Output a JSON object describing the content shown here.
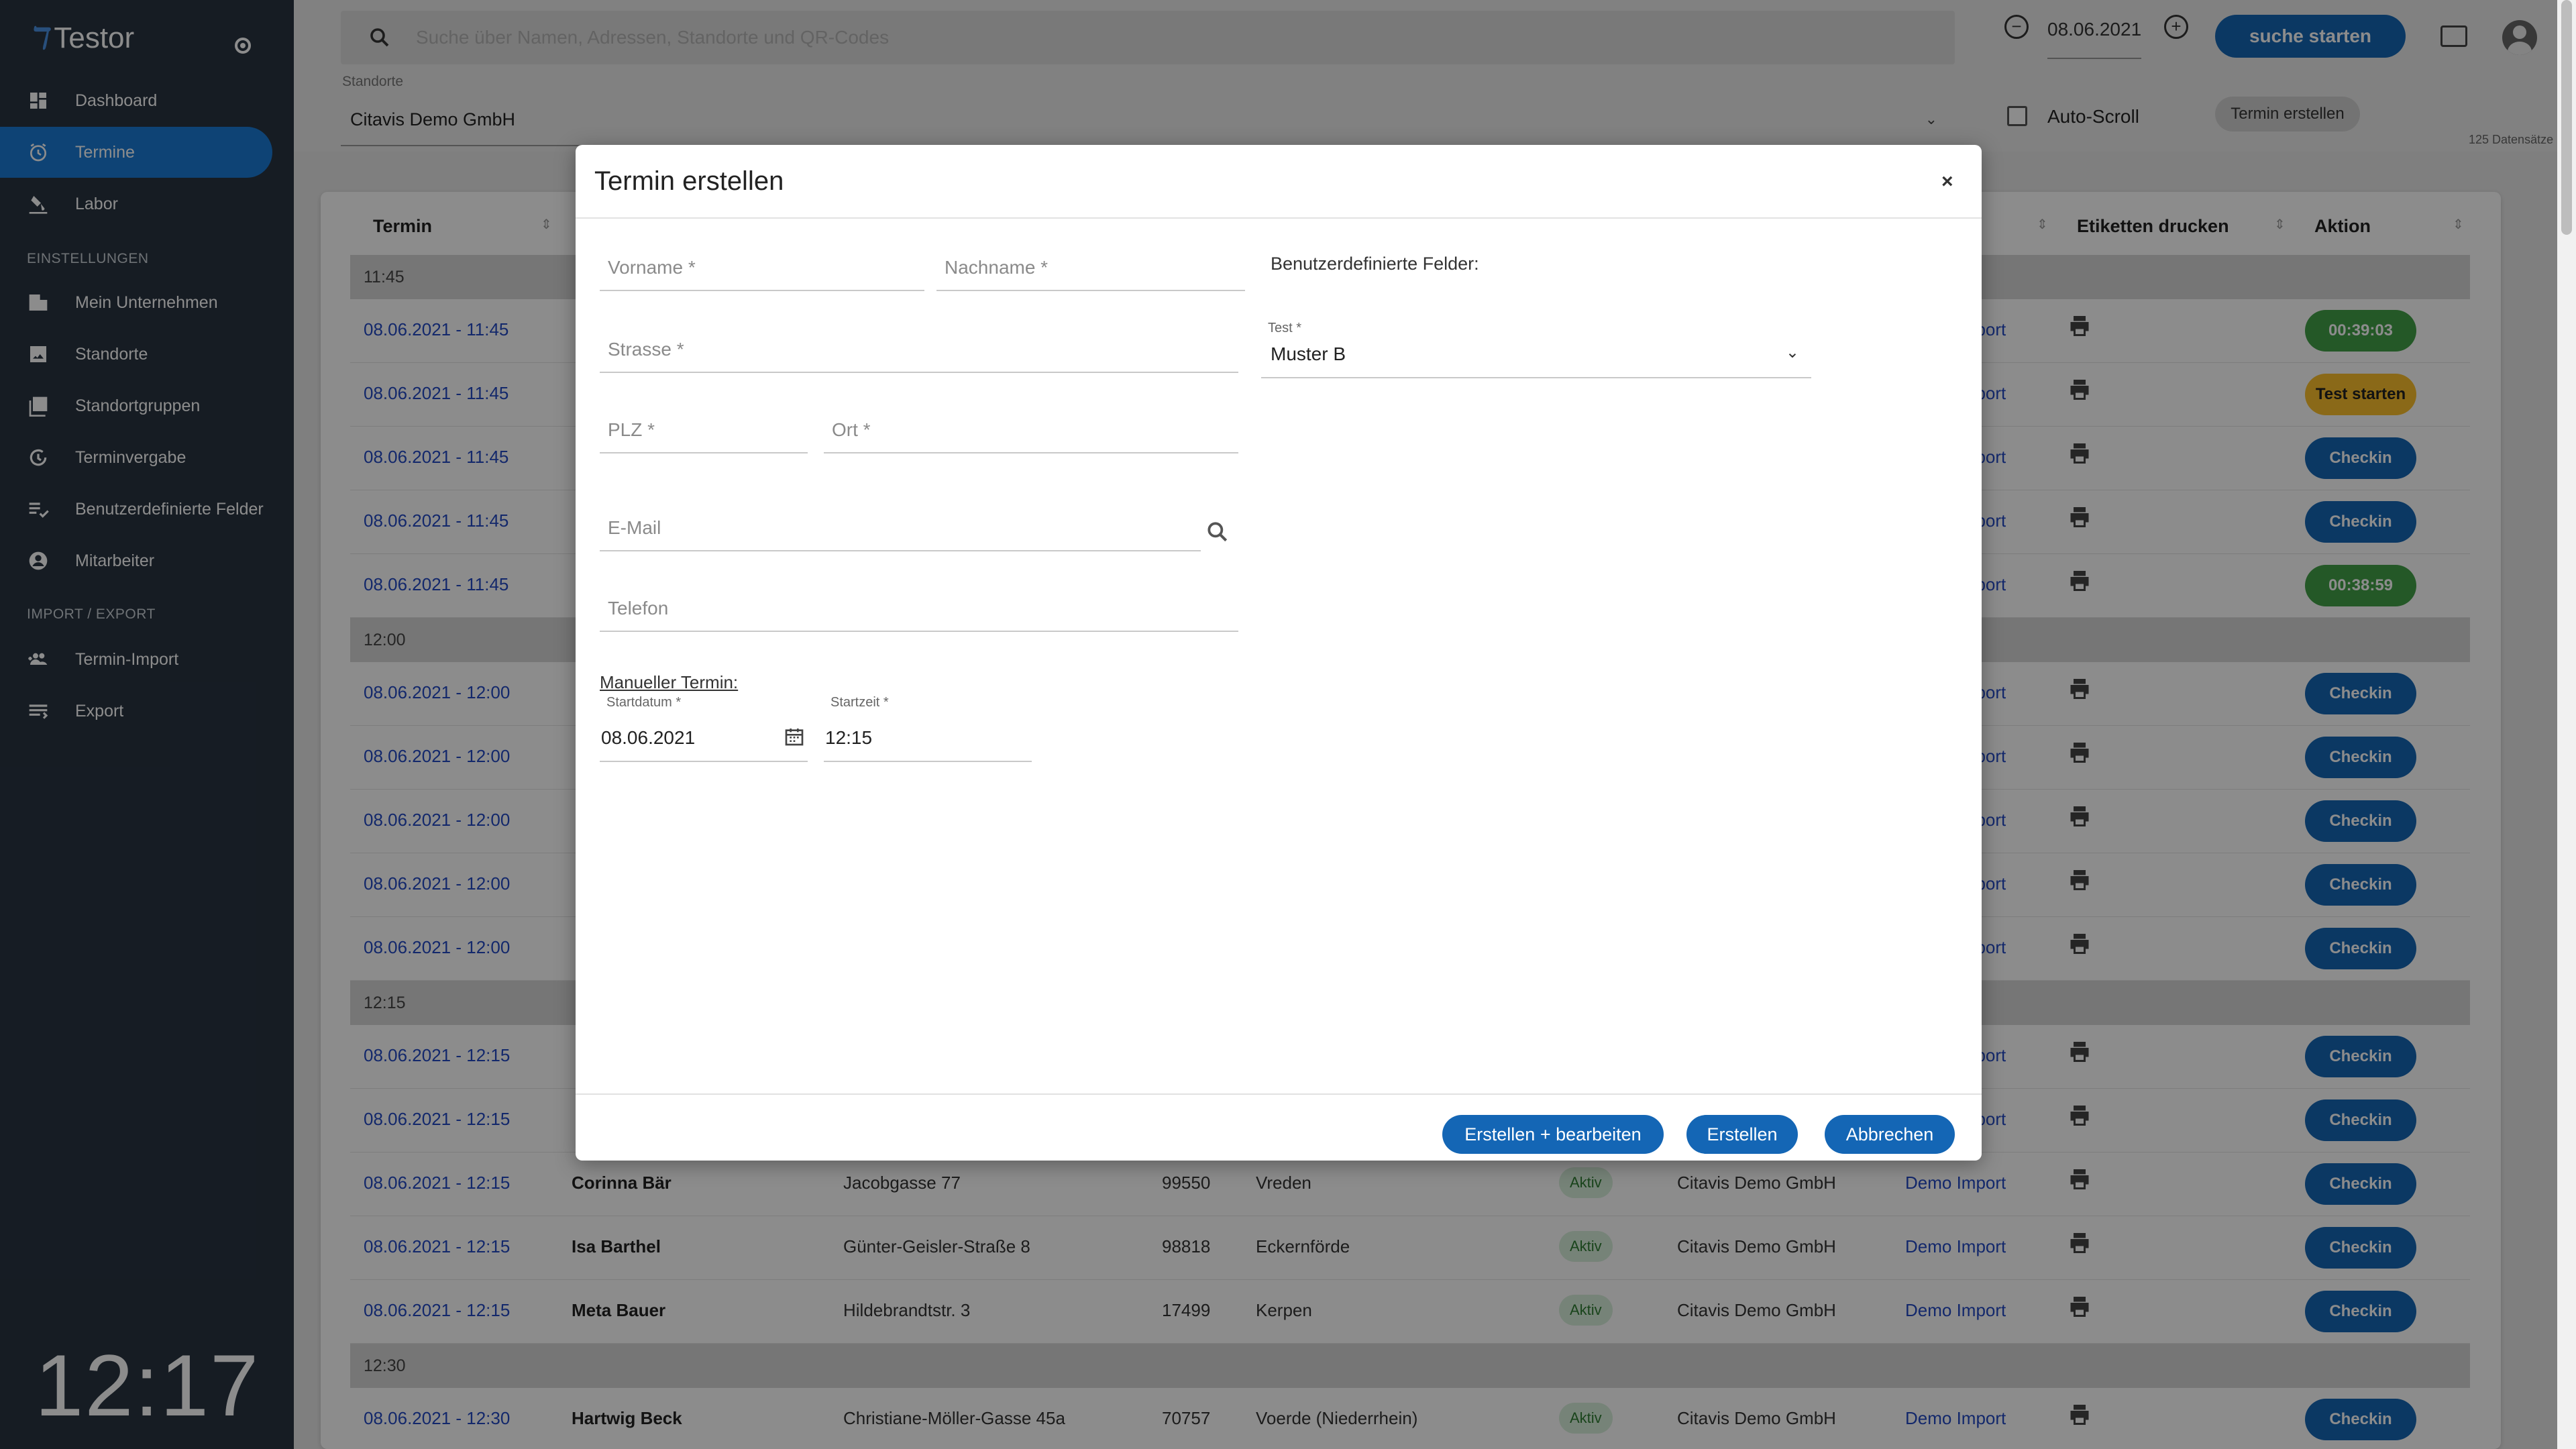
{
  "app": {
    "name": "Testor"
  },
  "sidebar": {
    "items": [
      {
        "label": "Dashboard",
        "icon": "dashboard-icon"
      },
      {
        "label": "Termine",
        "icon": "alarm-icon",
        "active": true
      },
      {
        "label": "Labor",
        "icon": "lab-icon"
      }
    ],
    "section_settings": "EINSTELLUNGEN",
    "settings_items": [
      {
        "label": "Mein Unternehmen",
        "icon": "building-icon"
      },
      {
        "label": "Standorte",
        "icon": "image-icon"
      },
      {
        "label": "Standortgruppen",
        "icon": "collection-icon"
      },
      {
        "label": "Terminvergabe",
        "icon": "refresh-clock-icon"
      },
      {
        "label": "Benutzerdefinierte Felder",
        "icon": "checklist-icon"
      },
      {
        "label": "Mitarbeiter",
        "icon": "person-icon"
      }
    ],
    "section_import": "IMPORT / EXPORT",
    "import_items": [
      {
        "label": "Termin-Import",
        "icon": "people-add-icon"
      },
      {
        "label": "Export",
        "icon": "export-lines-icon"
      }
    ],
    "clock": "12:17"
  },
  "topbar": {
    "search_placeholder": "Suche über Namen, Adressen, Standorte und QR-Codes",
    "date": "08.06.2021",
    "search_button": "suche starten",
    "location_label": "Standorte",
    "location_value": "Citavis Demo GmbH",
    "autoscroll_label": "Auto-Scroll",
    "create_button": "Termin erstellen",
    "records": "125 Datensätze"
  },
  "table": {
    "headers": {
      "termin": "Termin",
      "etiketten": "Etiketten drucken",
      "aktion": "Aktion"
    },
    "groups": [
      {
        "label": "11:45",
        "rows": [
          {
            "date": "08.06.2021 - 11:45",
            "action": "00:39:03",
            "kind": "timer"
          },
          {
            "date": "08.06.2021 - 11:45",
            "action": "Test starten",
            "kind": "test"
          },
          {
            "date": "08.06.2021 - 11:45",
            "action": "Checkin",
            "kind": "checkin"
          },
          {
            "date": "08.06.2021 - 11:45",
            "action": "Checkin",
            "kind": "checkin"
          },
          {
            "date": "08.06.2021 - 11:45",
            "action": "00:38:59",
            "kind": "timer"
          }
        ]
      },
      {
        "label": "12:00",
        "rows": [
          {
            "date": "08.06.2021 - 12:00",
            "action": "Checkin",
            "kind": "checkin"
          },
          {
            "date": "08.06.2021 - 12:00",
            "action": "Checkin",
            "kind": "checkin"
          },
          {
            "date": "08.06.2021 - 12:00",
            "action": "Checkin",
            "kind": "checkin"
          },
          {
            "date": "08.06.2021 - 12:00",
            "action": "Checkin",
            "kind": "checkin"
          },
          {
            "date": "08.06.2021 - 12:00",
            "action": "Checkin",
            "kind": "checkin"
          }
        ]
      },
      {
        "label": "12:15",
        "rows": [
          {
            "date": "08.06.2021 - 12:15",
            "action": "Checkin",
            "kind": "checkin"
          },
          {
            "date": "08.06.2021 - 12:15",
            "action": "Checkin",
            "kind": "checkin"
          },
          {
            "date": "08.06.2021 - 12:15",
            "name": "Corinna Bär",
            "street": "Jacobgasse 77",
            "plz": "99550",
            "city": "Vreden",
            "status": "Aktiv",
            "location": "Citavis Demo GmbH",
            "import": "Demo Import",
            "action": "Checkin",
            "kind": "checkin"
          },
          {
            "date": "08.06.2021 - 12:15",
            "name": "Isa Barthel",
            "street": "Günter-Geisler-Straße 8",
            "plz": "98818",
            "city": "Eckernförde",
            "status": "Aktiv",
            "location": "Citavis Demo GmbH",
            "import": "Demo Import",
            "action": "Checkin",
            "kind": "checkin"
          },
          {
            "date": "08.06.2021 - 12:15",
            "name": "Meta Bauer",
            "street": "Hildebrandtstr. 3",
            "plz": "17499",
            "city": "Kerpen",
            "status": "Aktiv",
            "location": "Citavis Demo GmbH",
            "import": "Demo Import",
            "action": "Checkin",
            "kind": "checkin"
          }
        ]
      },
      {
        "label": "12:30",
        "rows": [
          {
            "date": "08.06.2021 - 12:30",
            "name": "Hartwig Beck",
            "street": "Christiane-Möller-Gasse 45a",
            "plz": "70757",
            "city": "Voerde (Niederrhein)",
            "status": "Aktiv",
            "location": "Citavis Demo GmbH",
            "import": "Demo Import",
            "action": "Checkin",
            "kind": "checkin"
          }
        ]
      }
    ],
    "hidden_import": "Demo Import"
  },
  "modal": {
    "title": "Termin erstellen",
    "close": "×",
    "vorname_placeholder": "Vorname *",
    "nachname_placeholder": "Nachname *",
    "strasse_placeholder": "Strasse *",
    "plz_placeholder": "PLZ *",
    "ort_placeholder": "Ort *",
    "email_placeholder": "E-Mail",
    "telefon_placeholder": "Telefon",
    "custom_fields_title": "Benutzerdefinierte Felder:",
    "test_label": "Test *",
    "test_value": "Muster B",
    "manual_label": "Manueller Termin:",
    "startdatum_label": "Startdatum *",
    "startdatum_value": "08.06.2021",
    "startzeit_label": "Startzeit *",
    "startzeit_value": "12:15",
    "btn_create_edit": "Erstellen + bearbeiten",
    "btn_create": "Erstellen",
    "btn_cancel": "Abbrechen"
  },
  "colors": {
    "sidebar": "#283341",
    "accent": "#1466b5",
    "active_nav": "#1a7bd6",
    "timer": "#43a047",
    "test": "#fbc02d"
  }
}
